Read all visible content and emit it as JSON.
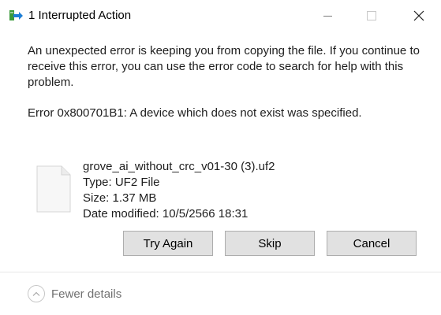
{
  "window": {
    "title": "1 Interrupted Action"
  },
  "message": {
    "body": "An unexpected error is keeping you from copying the file. If you continue to receive this error, you can use the error code to search for help with this problem.",
    "error": "Error 0x800701B1: A device which does not exist was specified."
  },
  "file": {
    "name": "grove_ai_without_crc_v01-30 (3).uf2",
    "type": "Type: UF2 File",
    "size": "Size: 1.37 MB",
    "date_modified": "Date modified: 10/5/2566 18:31",
    "icon": "document-icon"
  },
  "buttons": {
    "try_again": "Try Again",
    "skip": "Skip",
    "cancel": "Cancel"
  },
  "footer": {
    "details_toggle": "Fewer details",
    "toggle_icon": "chevron-up-icon"
  },
  "colors": {
    "button_bg": "#e1e1e1",
    "button_border": "#adadad",
    "app_icon_green": "#3a9a3a",
    "app_icon_blue": "#1e7fd6"
  }
}
